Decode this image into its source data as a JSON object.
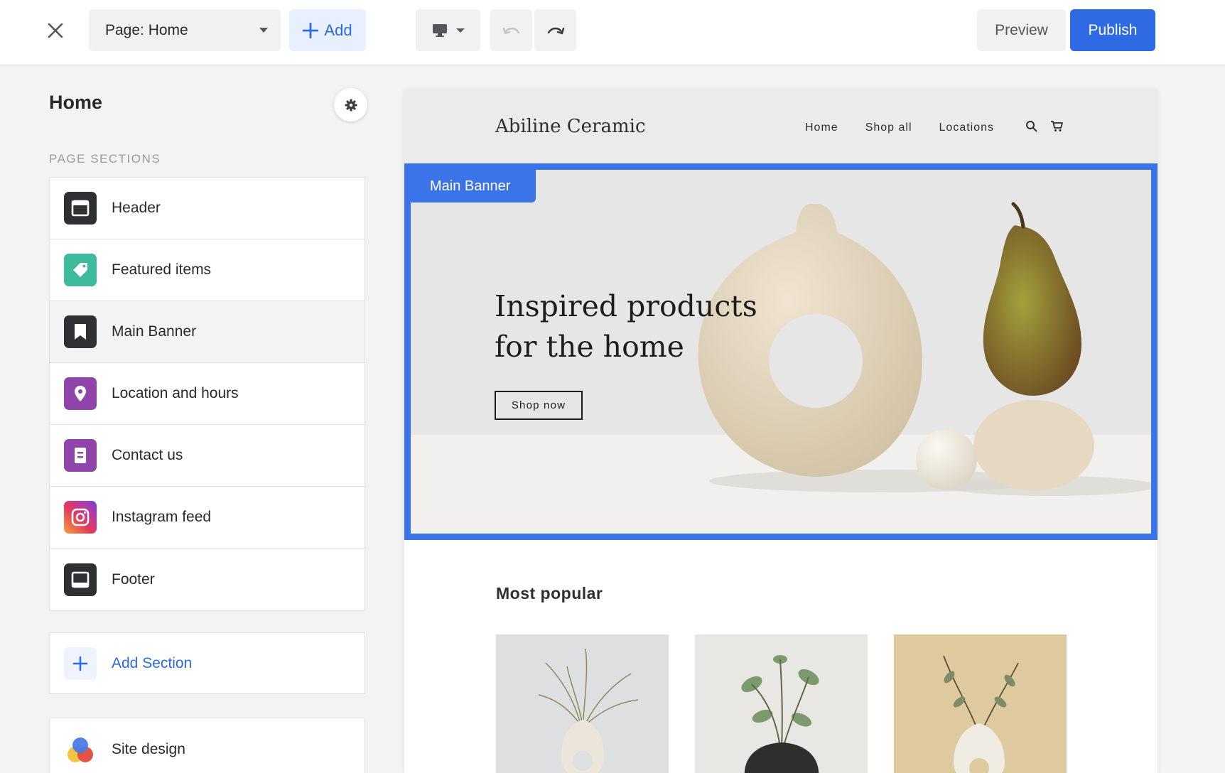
{
  "toolbar": {
    "page_select": "Page: Home",
    "add_label": "Add",
    "preview_label": "Preview",
    "publish_label": "Publish"
  },
  "sidebar": {
    "title": "Home",
    "sections_heading": "PAGE SECTIONS",
    "items": [
      {
        "label": "Header",
        "icon": "header-layout-icon"
      },
      {
        "label": "Featured items",
        "icon": "tag-icon"
      },
      {
        "label": "Main Banner",
        "icon": "bookmark-icon"
      },
      {
        "label": "Location and hours",
        "icon": "map-pin-icon"
      },
      {
        "label": "Contact us",
        "icon": "contact-card-icon"
      },
      {
        "label": "Instagram feed",
        "icon": "instagram-icon"
      },
      {
        "label": "Footer",
        "icon": "footer-layout-icon"
      }
    ],
    "add_section_label": "Add Section",
    "site_design_label": "Site design"
  },
  "site": {
    "brand": "Abiline Ceramic",
    "nav": [
      "Home",
      "Shop all",
      "Locations"
    ],
    "banner_tag": "Main Banner",
    "hero_line1": "Inspired products",
    "hero_line2": "for the home",
    "shop_button": "Shop now",
    "popular_title": "Most popular"
  },
  "colors": {
    "accent": "#2d6ae3",
    "selection": "#3b73e8",
    "featured_icon": "#3dbb9c",
    "location_icon": "#8e44a8",
    "contact_icon": "#8e44a8",
    "dark_icon": "#2f3033"
  }
}
